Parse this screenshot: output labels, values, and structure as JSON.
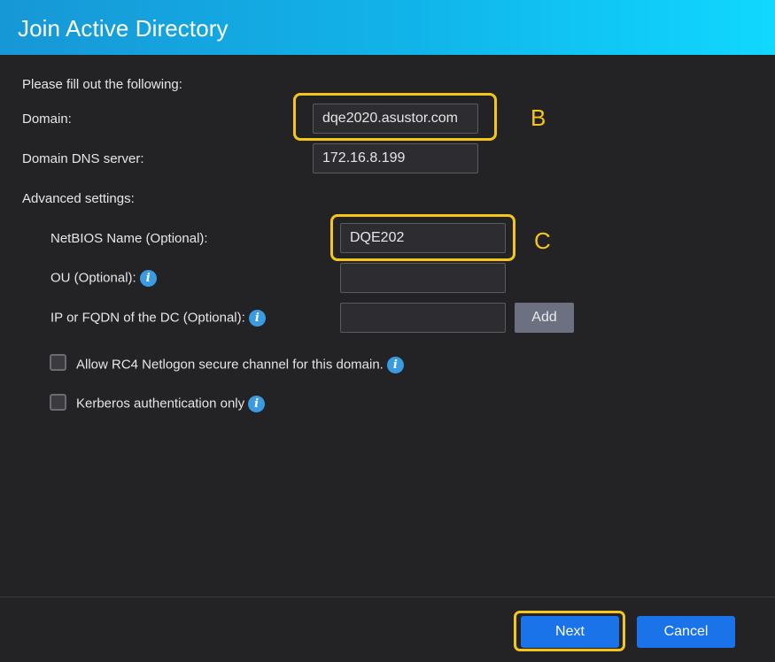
{
  "dialog": {
    "title": "Join Active Directory"
  },
  "form": {
    "intro": "Please fill out the following:",
    "domain_label": "Domain:",
    "domain_value": "dqe2020.asustor.com",
    "dns_label": "Domain DNS server:",
    "dns_value": "172.16.8.199",
    "advanced_label": "Advanced settings:",
    "netbios_label": "NetBIOS Name (Optional):",
    "netbios_value": "DQE202",
    "ou_label": "OU (Optional):",
    "ou_value": "",
    "dc_label": "IP or FQDN of the DC (Optional):",
    "dc_value": "",
    "add_label": "Add",
    "rc4_label": "Allow RC4 Netlogon secure channel for this domain.",
    "rc4_checked": false,
    "kerberos_label": "Kerberos authentication only",
    "kerberos_checked": false
  },
  "annotations": {
    "marker_b": "B",
    "marker_c": "C",
    "highlight_color": "#f5c518"
  },
  "footer": {
    "next_label": "Next",
    "cancel_label": "Cancel"
  },
  "colors": {
    "title_gradient_start": "#1797d6",
    "title_gradient_end": "#10d8ff",
    "primary_button": "#1a73e8",
    "background": "#232326"
  },
  "icons": {
    "info": "info-icon"
  }
}
